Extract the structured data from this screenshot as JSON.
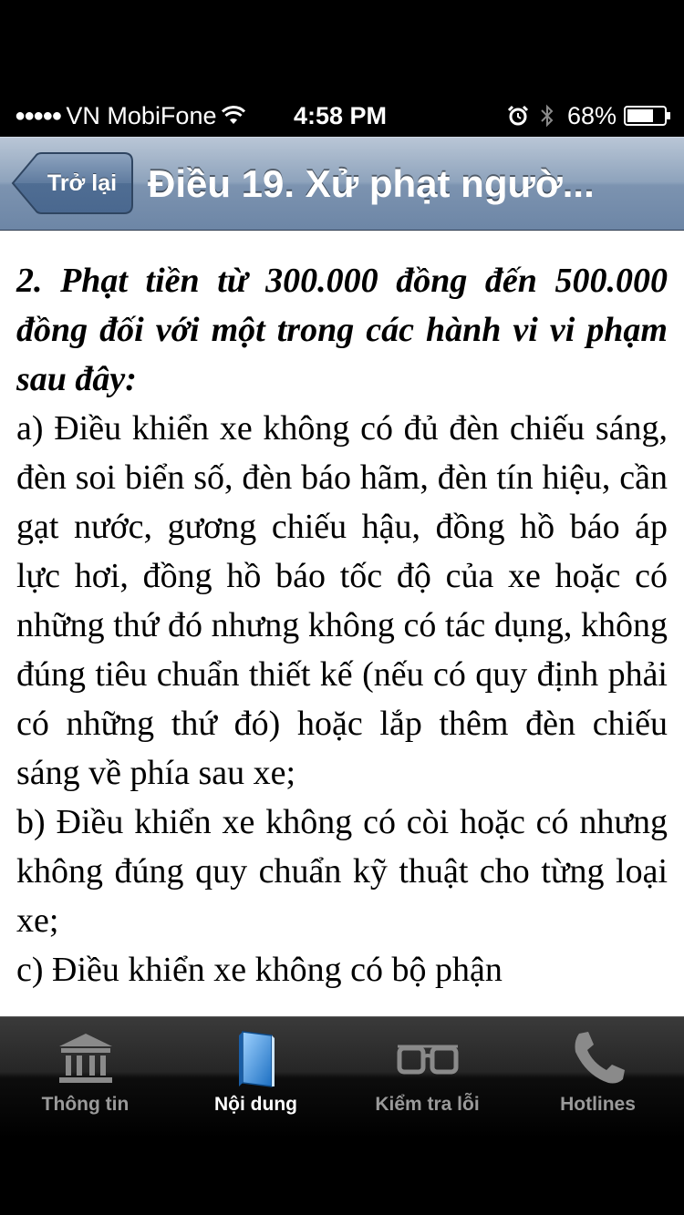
{
  "status_bar": {
    "signal": "●●●●●",
    "carrier": "VN MobiFone",
    "time": "4:58 PM",
    "battery": "68%",
    "icons": [
      "wifi-icon",
      "alarm-icon",
      "bluetooth-icon",
      "battery-icon"
    ]
  },
  "nav": {
    "back_label": "Trở lại",
    "title": "Điều 19. Xử phạt ngườ..."
  },
  "article": {
    "heading": "2. Phạt tiền từ 300.000 đồng đến 500.000 đồng đối với một trong các hành vi vi phạm sau đây:",
    "items": [
      "a) Điều khiển xe không có đủ đèn chiếu sáng, đèn soi biển số, đèn báo hãm, đèn tín hiệu, cần gạt nước, gương chiếu hậu, đồng hồ báo áp lực hơi, đồng hồ báo tốc độ của xe hoặc có những thứ đó nhưng không có tác dụng, không đúng tiêu chuẩn thiết kế (nếu có quy định phải có những thứ đó) hoặc lắp thêm đèn chiếu sáng về phía sau xe;",
      "b) Điều khiển xe không có còi hoặc có nhưng không đúng quy chuẩn kỹ thuật cho từng loại xe;",
      "c) Điều khiển xe không có bộ phận"
    ]
  },
  "tabs": [
    {
      "label": "Thông tin",
      "icon": "building-icon",
      "active": false
    },
    {
      "label": "Nội dung",
      "icon": "book-icon",
      "active": true
    },
    {
      "label": "Kiểm tra lỗi",
      "icon": "glasses-icon",
      "active": false
    },
    {
      "label": "Hotlines",
      "icon": "phone-icon",
      "active": false
    }
  ],
  "colors": {
    "nav_bar": "#7c93b0",
    "active_tab_icon": "#2a8fe0"
  }
}
